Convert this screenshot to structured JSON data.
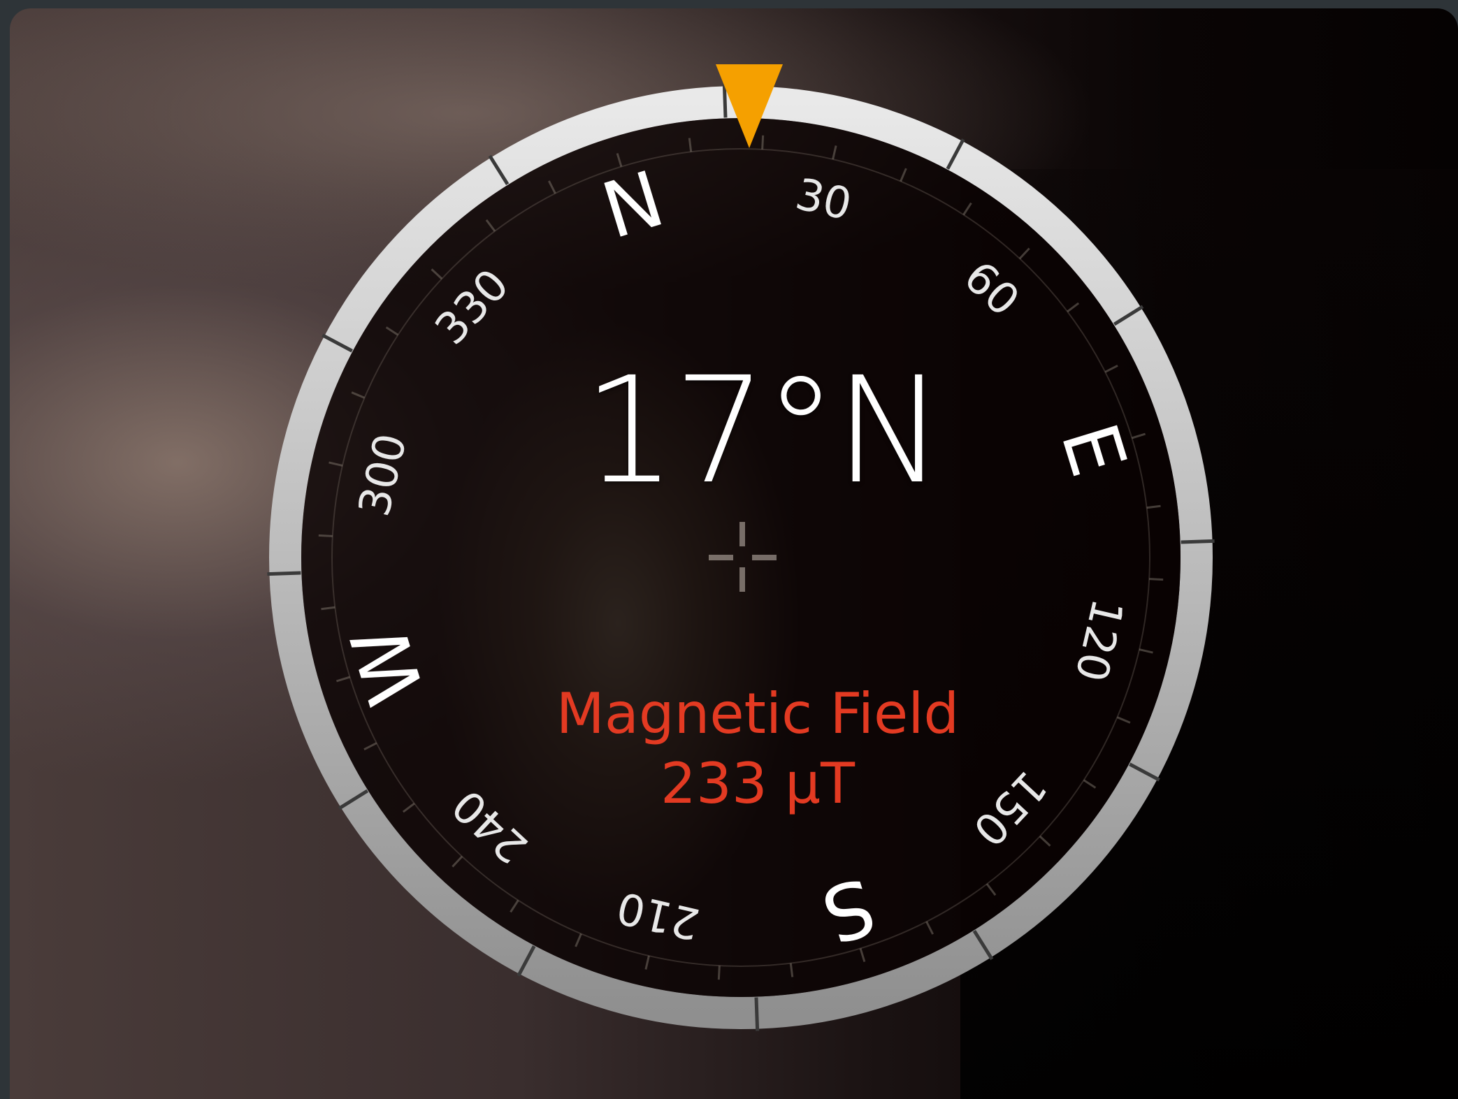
{
  "compass": {
    "heading_degrees": 17,
    "heading_text": "17°N",
    "cardinals": [
      {
        "label": "N",
        "bearing": 0
      },
      {
        "label": "E",
        "bearing": 90
      },
      {
        "label": "S",
        "bearing": 180
      },
      {
        "label": "W",
        "bearing": 270
      }
    ],
    "degree_labels": [
      {
        "label": "30",
        "bearing": 30
      },
      {
        "label": "60",
        "bearing": 60
      },
      {
        "label": "120",
        "bearing": 120
      },
      {
        "label": "150",
        "bearing": 150
      },
      {
        "label": "210",
        "bearing": 210
      },
      {
        "label": "240",
        "bearing": 240
      },
      {
        "label": "300",
        "bearing": 300
      },
      {
        "label": "330",
        "bearing": 330
      }
    ],
    "pointer_color": "#f5a000"
  },
  "magnetic_field": {
    "label": "Magnetic Field",
    "value": "233 µT",
    "color": "#e33a22"
  },
  "icons": {
    "pointer": "triangle-down-pointer-icon",
    "crosshair": "crosshair-icon"
  }
}
